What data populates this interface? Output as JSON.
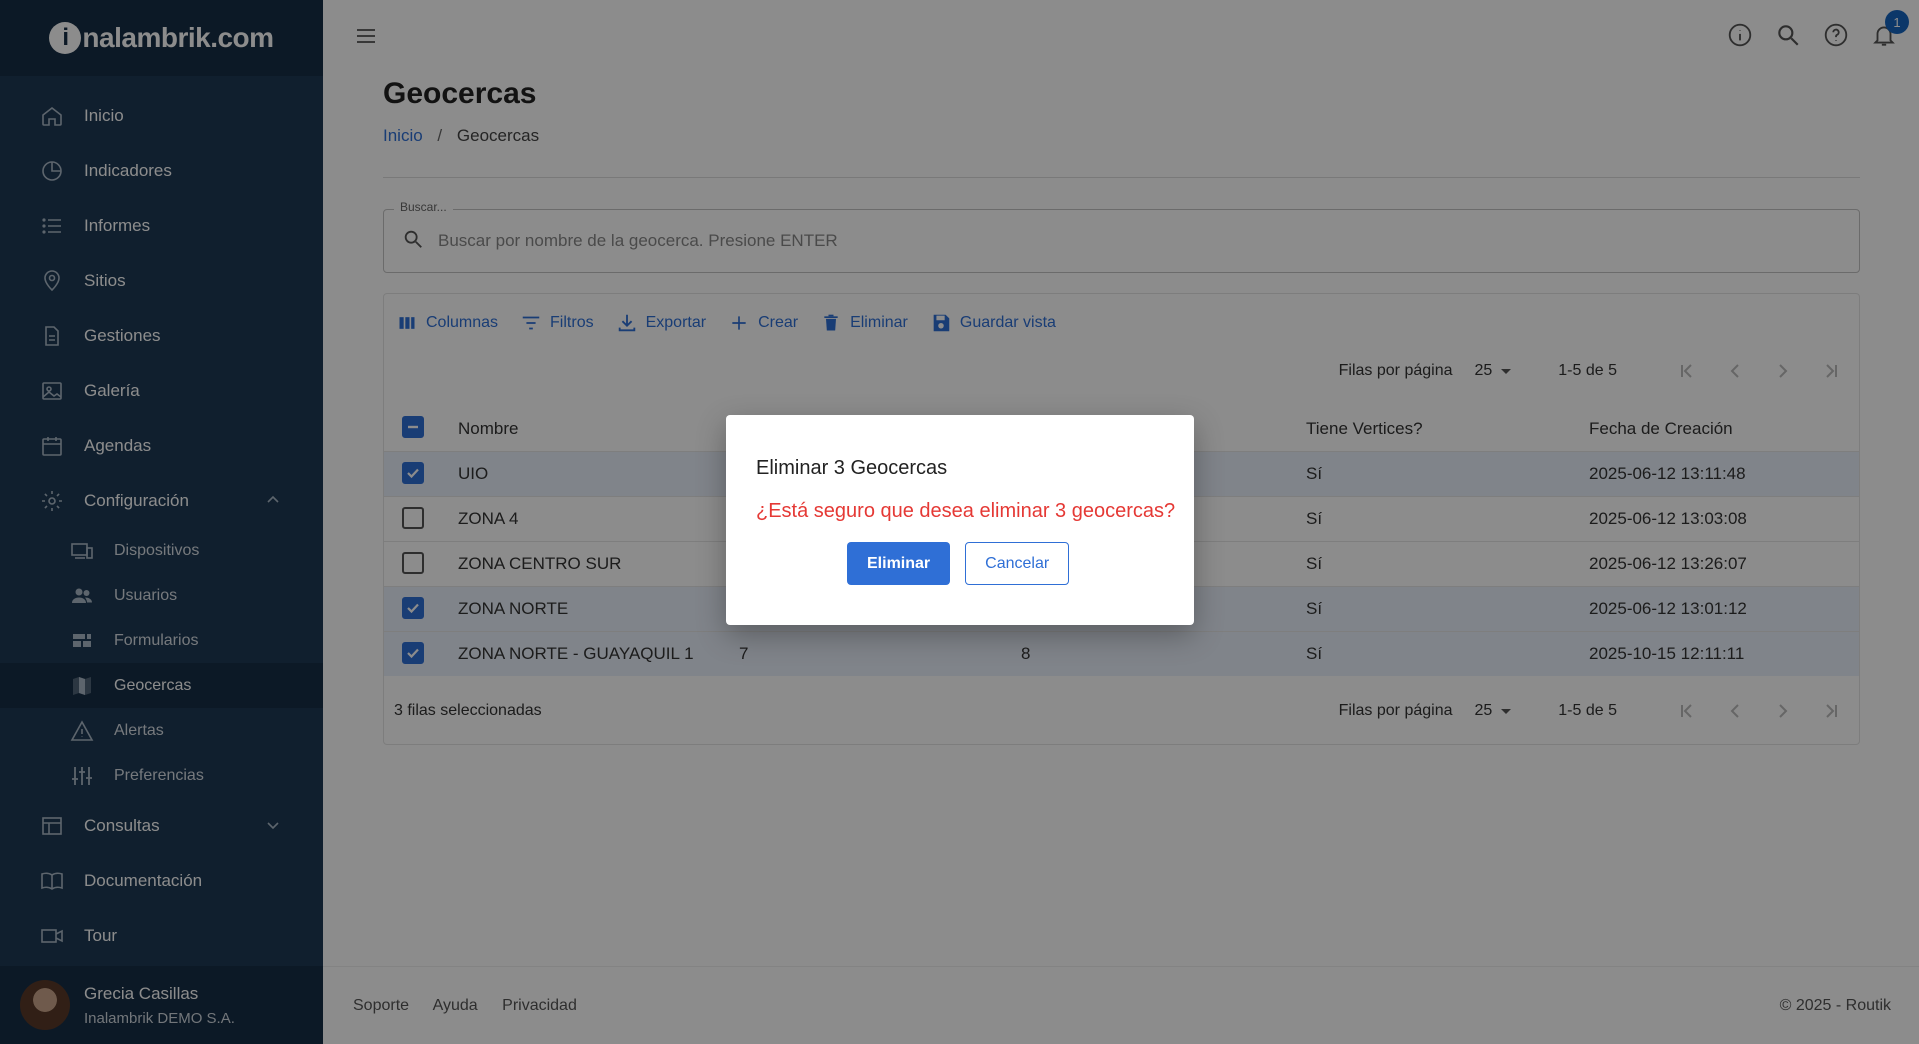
{
  "brand": {
    "logo_text": "nalambrik.com",
    "logo_letter": "i"
  },
  "sidebar": {
    "items": [
      {
        "label": "Inicio",
        "icon": "home-icon"
      },
      {
        "label": "Indicadores",
        "icon": "pie-chart-icon"
      },
      {
        "label": "Informes",
        "icon": "list-icon"
      },
      {
        "label": "Sitios",
        "icon": "location-pin-icon"
      },
      {
        "label": "Gestiones",
        "icon": "document-icon"
      },
      {
        "label": "Galería",
        "icon": "image-icon"
      },
      {
        "label": "Agendas",
        "icon": "calendar-icon"
      },
      {
        "label": "Configuración",
        "icon": "gear-icon"
      }
    ],
    "sub_items": [
      {
        "label": "Dispositivos",
        "icon": "devices-icon"
      },
      {
        "label": "Usuarios",
        "icon": "users-icon"
      },
      {
        "label": "Formularios",
        "icon": "forms-icon"
      },
      {
        "label": "Geocercas",
        "icon": "map-icon"
      },
      {
        "label": "Alertas",
        "icon": "warning-icon"
      },
      {
        "label": "Preferencias",
        "icon": "sliders-icon"
      }
    ],
    "bottom_items": [
      {
        "label": "Consultas",
        "icon": "table-icon"
      },
      {
        "label": "Documentación",
        "icon": "book-icon"
      },
      {
        "label": "Tour",
        "icon": "video-icon"
      }
    ],
    "user": {
      "name": "Grecia Casillas",
      "org": "Inalambrik DEMO S.A."
    }
  },
  "topbar": {
    "notification_count": "1"
  },
  "page": {
    "title": "Geocercas",
    "breadcrumb": {
      "home": "Inicio",
      "current": "Geocercas"
    }
  },
  "search": {
    "label": "Buscar...",
    "placeholder": "Buscar por nombre de la geocerca. Presione ENTER"
  },
  "toolbar": {
    "columns": "Columnas",
    "filters": "Filtros",
    "export": "Exportar",
    "create": "Crear",
    "delete": "Eliminar",
    "save_view": "Guardar vista"
  },
  "pagination": {
    "rows_label": "Filas por página",
    "rows_value": "25",
    "range": "1-5 de 5"
  },
  "table": {
    "headers": {
      "name": "Nombre",
      "vertices": "Tiene Vertices?",
      "created": "Fecha de Creación"
    },
    "rows": [
      {
        "name": "UIO",
        "a": "",
        "b": "",
        "vertices": "Sí",
        "created": "2025-06-12 13:11:48",
        "checked": true
      },
      {
        "name": "ZONA 4",
        "a": "",
        "b": "",
        "vertices": "Sí",
        "created": "2025-06-12 13:03:08",
        "checked": false
      },
      {
        "name": "ZONA CENTRO SUR",
        "a": "",
        "b": "",
        "vertices": "Sí",
        "created": "2025-06-12 13:26:07",
        "checked": false
      },
      {
        "name": "ZONA NORTE",
        "a": "",
        "b": "",
        "vertices": "Sí",
        "created": "2025-06-12 13:01:12",
        "checked": true
      },
      {
        "name": "ZONA NORTE - GUAYAQUIL 1",
        "a": "7",
        "b": "8",
        "vertices": "Sí",
        "created": "2025-10-15 12:11:11",
        "checked": true
      }
    ],
    "selected_text": "3 filas seleccionadas"
  },
  "footer": {
    "support": "Soporte",
    "help": "Ayuda",
    "privacy": "Privacidad",
    "copyright": "© 2025 - Routik"
  },
  "dialog": {
    "title": "Eliminar 3 Geocercas",
    "message": "¿Está seguro que desea eliminar 3 geocercas?",
    "confirm": "Eliminar",
    "cancel": "Cancelar"
  },
  "colors": {
    "sidebar": "#1e3a55",
    "accent": "#2f6fd6",
    "danger": "#e53935"
  }
}
